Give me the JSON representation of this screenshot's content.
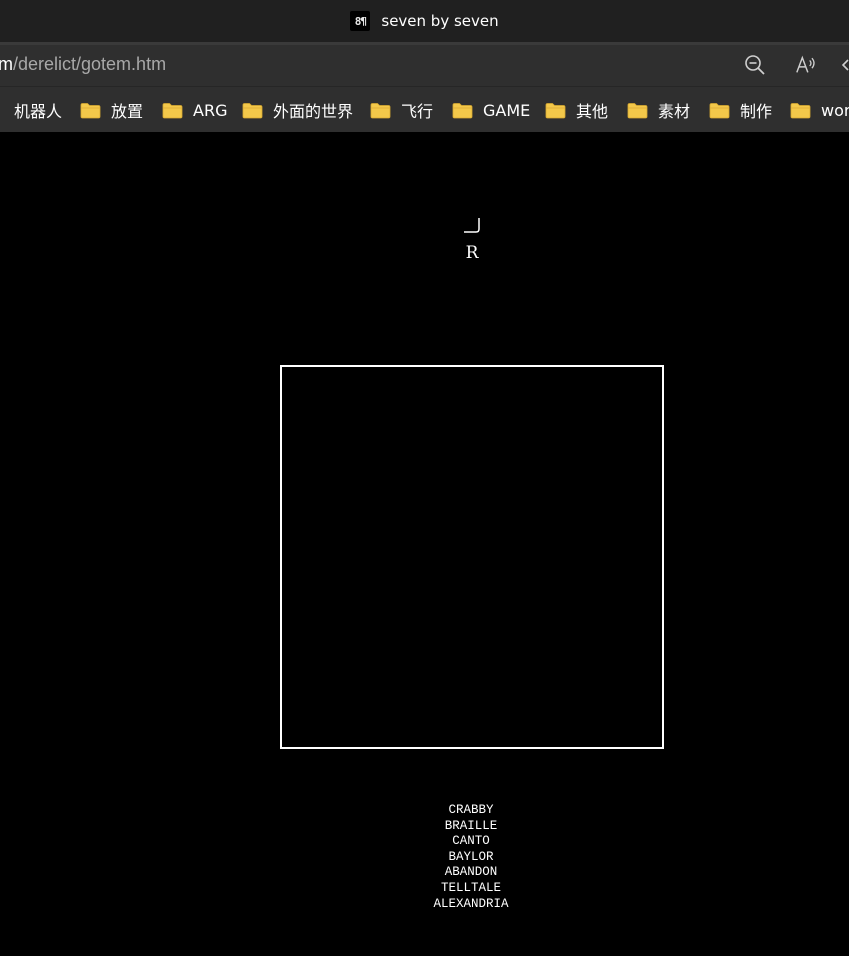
{
  "window": {
    "title": "seven by seven",
    "favicon_text": "8¶"
  },
  "address_bar": {
    "url_host_fragment": "m",
    "url_path": "/derelict/gotem.htm",
    "icons": [
      "zoom-out-icon",
      "read-aloud-icon",
      "more-icon"
    ]
  },
  "bookmarks": {
    "items": [
      {
        "label": "机器人"
      },
      {
        "label": "放置"
      },
      {
        "label": "ARG"
      },
      {
        "label": "外面的世界"
      },
      {
        "label": "飞行"
      },
      {
        "label": "GAME"
      },
      {
        "label": "其他"
      },
      {
        "label": "素材"
      },
      {
        "label": "制作"
      },
      {
        "label": "work"
      }
    ],
    "folder_color": "#f3c84a"
  },
  "page": {
    "background": "#000000",
    "corner_glyph": "corner-bracket-icon",
    "rotate_label": "R",
    "grid_border_color": "#ffffff",
    "words": [
      "CRABBY",
      "BRAILLE",
      "CANTO",
      "BAYLOR",
      "ABANDON",
      "TELLTALE",
      "ALEXANDRIA"
    ]
  }
}
